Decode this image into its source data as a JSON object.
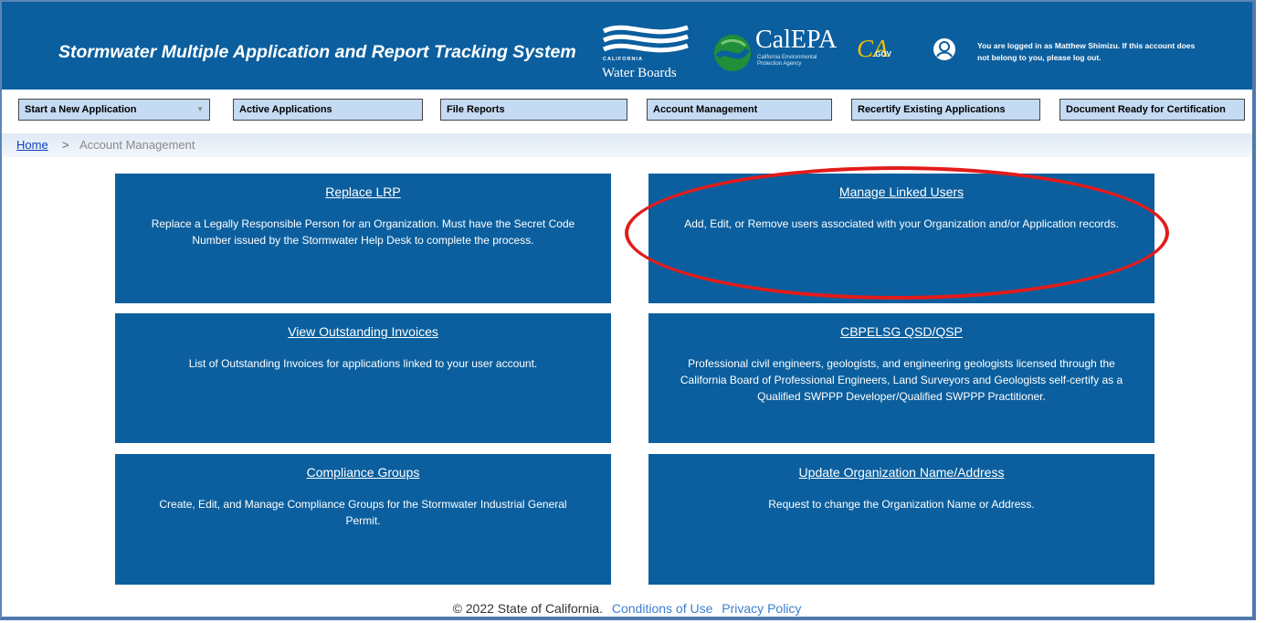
{
  "header": {
    "title": "Stormwater Multiple Application and Report Tracking System",
    "water_boards_small": "CALIFORNIA",
    "water_boards_label": "Water Boards",
    "calepa_label": "CalEPA",
    "calepa_sub": "California Environmental Protection Agency",
    "cagov_ca": "CA",
    "cagov_gov": ".GOV",
    "login_message": "You are logged in as Matthew Shimizu. If this account does not belong to you, please log out."
  },
  "nav": {
    "items": [
      {
        "label": "Start a New Application",
        "has_dropdown": true
      },
      {
        "label": "Active Applications"
      },
      {
        "label": "File Reports"
      },
      {
        "label": "Account Management"
      },
      {
        "label": "Recertify Existing Applications"
      },
      {
        "label": "Document Ready for Certification"
      }
    ]
  },
  "breadcrumb": {
    "home": "Home",
    "separator": ">",
    "current": "Account Management"
  },
  "tiles": [
    {
      "title": "Replace LRP",
      "desc": "Replace a Legally Responsible Person for an Organization. Must have the Secret Code Number issued by the Stormwater Help Desk to complete the process."
    },
    {
      "title": "Manage Linked Users",
      "desc": "Add, Edit, or Remove users associated with your Organization and/or Application records."
    },
    {
      "title": "View Outstanding Invoices",
      "desc": "List of Outstanding Invoices for applications linked to your user account."
    },
    {
      "title": "CBPELSG QSD/QSP",
      "desc": "Professional civil engineers, geologists, and engineering geologists licensed through the California Board of Professional Engineers, Land Surveyors and Geologists self-certify as a Qualified SWPPP Developer/Qualified SWPPP Practitioner."
    },
    {
      "title": "Compliance Groups",
      "desc": "Create, Edit, and Manage Compliance Groups for the Stormwater Industrial General Permit."
    },
    {
      "title": "Update Organization Name/Address",
      "desc": "Request to change the Organization Name or Address."
    }
  ],
  "footer": {
    "copyright": "© 2022 State of California.",
    "conditions": "Conditions of Use",
    "privacy": "Privacy Policy"
  },
  "colors": {
    "header_bg": "#0b5f9e",
    "nav_button_bg": "#c5dbf3",
    "highlight_oval": "#e41b1b",
    "link": "#3b7fd0"
  }
}
